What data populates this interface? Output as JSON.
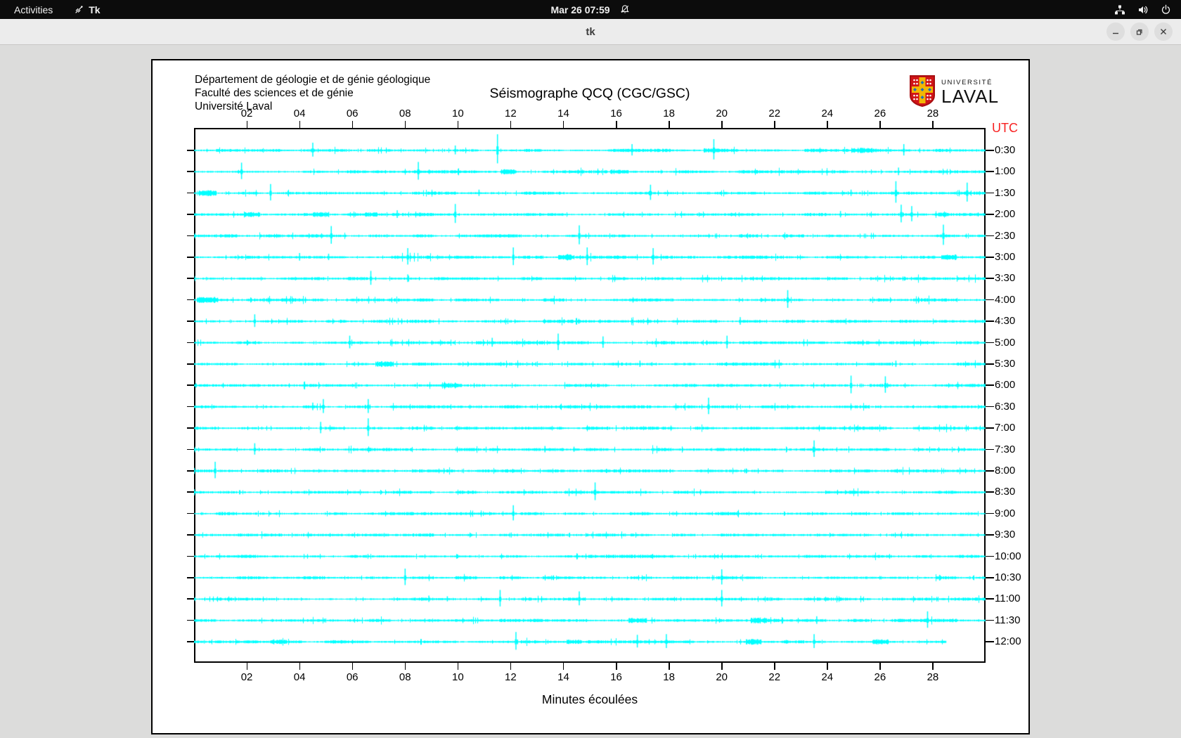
{
  "topbar": {
    "activities_label": "Activities",
    "app_menu_label": "Tk",
    "clock": "Mar 26 07:59"
  },
  "window": {
    "title": "tk"
  },
  "header": {
    "line1": "Département de géologie et de génie géologique",
    "line2": "Faculté des sciences et de génie",
    "line3": "Université Laval"
  },
  "logo": {
    "top": "UNIVERSITÉ",
    "bottom": "LAVAL"
  },
  "icons": {
    "topbar": [
      "tk-icon",
      "bell-muted-icon",
      "network-icon",
      "volume-icon",
      "power-icon"
    ],
    "window_controls": [
      "minimize-icon",
      "restore-icon",
      "close-icon"
    ]
  },
  "chart_data": {
    "type": "line",
    "subtype": "seismogram-helicorder",
    "title": "Séismographe QCQ (CGC/GSC)",
    "xlabel": "Minutes écoulées",
    "right_axis_label": "UTC",
    "right_axis_color": "#f82222",
    "trace_color": "#00ffff",
    "x_range_minutes": [
      0,
      30
    ],
    "x_ticks": [
      "02",
      "04",
      "06",
      "08",
      "10",
      "12",
      "14",
      "16",
      "18",
      "20",
      "22",
      "24",
      "26",
      "28"
    ],
    "grid": false,
    "rows": [
      {
        "label": "0:30",
        "end": 30,
        "spikes": [
          [
            4.5,
            11
          ],
          [
            9.9,
            7
          ],
          [
            11.5,
            23
          ],
          [
            16.6,
            9
          ],
          [
            19.7,
            16
          ],
          [
            26.9,
            9
          ]
        ],
        "patches": [
          [
            19.6,
            0.3,
            3
          ],
          [
            25.3,
            0.4,
            3.5
          ]
        ]
      },
      {
        "label": "1:00",
        "end": 30,
        "spikes": [
          [
            1.8,
            13
          ],
          [
            8.5,
            14
          ],
          [
            26.7,
            6
          ]
        ],
        "patches": [
          [
            11.9,
            0.3,
            3.5
          ],
          [
            16.1,
            0.35,
            3
          ]
        ]
      },
      {
        "label": "1:30",
        "end": 30,
        "spikes": [
          [
            2.9,
            13
          ],
          [
            10.8,
            5
          ],
          [
            17.3,
            12
          ],
          [
            24.9,
            5
          ],
          [
            26.6,
            17
          ],
          [
            29.3,
            15
          ]
        ],
        "patches": [
          [
            0.5,
            0.35,
            4
          ]
        ]
      },
      {
        "label": "2:00",
        "end": 30,
        "spikes": [
          [
            7.7,
            6
          ],
          [
            9.9,
            15
          ],
          [
            24.5,
            5
          ],
          [
            26.8,
            14
          ],
          [
            27.2,
            12
          ]
        ],
        "patches": [
          [
            2.2,
            0.3,
            3.5
          ],
          [
            4.8,
            0.3,
            3.5
          ],
          [
            6.7,
            0.25,
            3
          ],
          [
            28.4,
            0.2,
            3
          ]
        ]
      },
      {
        "label": "2:30",
        "end": 30,
        "spikes": [
          [
            5.2,
            14
          ],
          [
            14.6,
            15
          ],
          [
            28.4,
            16
          ]
        ],
        "patches": []
      },
      {
        "label": "3:00",
        "end": 30,
        "spikes": [
          [
            4.0,
            6
          ],
          [
            5.1,
            5
          ],
          [
            8.1,
            13
          ],
          [
            12.1,
            14
          ],
          [
            14.9,
            14
          ],
          [
            17.4,
            13
          ]
        ],
        "patches": [
          [
            14.1,
            0.3,
            4
          ],
          [
            28.6,
            0.3,
            4
          ]
        ]
      },
      {
        "label": "3:30",
        "end": 30,
        "spikes": [
          [
            6.7,
            11
          ],
          [
            8.1,
            6
          ]
        ],
        "patches": []
      },
      {
        "label": "4:00",
        "end": 30,
        "spikes": [
          [
            22.5,
            14
          ]
        ],
        "patches": [
          [
            0.5,
            0.4,
            4
          ]
        ]
      },
      {
        "label": "4:30",
        "end": 30,
        "spikes": [
          [
            2.3,
            10
          ],
          [
            20.7,
            6
          ]
        ],
        "patches": []
      },
      {
        "label": "5:00",
        "end": 30,
        "spikes": [
          [
            5.9,
            10
          ],
          [
            11.3,
            7
          ],
          [
            13.8,
            13
          ],
          [
            15.5,
            9
          ],
          [
            20.2,
            10
          ]
        ],
        "patches": []
      },
      {
        "label": "5:30",
        "end": 30,
        "spikes": [
          [
            16.9,
            5
          ],
          [
            26.6,
            5
          ]
        ],
        "patches": [
          [
            7.2,
            0.35,
            4
          ]
        ]
      },
      {
        "label": "6:00",
        "end": 30,
        "spikes": [
          [
            24.9,
            14
          ],
          [
            26.2,
            13
          ]
        ],
        "patches": [
          [
            9.8,
            0.3,
            3.5
          ]
        ]
      },
      {
        "label": "6:30",
        "end": 30,
        "spikes": [
          [
            4.5,
            6
          ],
          [
            4.9,
            11
          ],
          [
            6.6,
            11
          ],
          [
            19.5,
            13
          ]
        ],
        "patches": []
      },
      {
        "label": "7:00",
        "end": 30,
        "spikes": [
          [
            4.8,
            9
          ],
          [
            6.6,
            14
          ]
        ],
        "patches": []
      },
      {
        "label": "7:30",
        "end": 30,
        "spikes": [
          [
            2.3,
            9
          ],
          [
            13.3,
            5
          ],
          [
            14.4,
            4
          ],
          [
            23.5,
            13
          ]
        ],
        "patches": []
      },
      {
        "label": "8:00",
        "end": 30,
        "spikes": [
          [
            0.8,
            13
          ]
        ],
        "patches": []
      },
      {
        "label": "8:30",
        "end": 30,
        "spikes": [
          [
            15.2,
            14
          ]
        ],
        "patches": []
      },
      {
        "label": "9:00",
        "end": 30,
        "spikes": [
          [
            12.1,
            12
          ]
        ],
        "patches": []
      },
      {
        "label": "9:30",
        "end": 30,
        "spikes": [],
        "patches": []
      },
      {
        "label": "10:00",
        "end": 30,
        "spikes": [],
        "patches": []
      },
      {
        "label": "10:30",
        "end": 30,
        "spikes": [
          [
            8.0,
            13
          ],
          [
            20.0,
            12
          ]
        ],
        "patches": []
      },
      {
        "label": "11:00",
        "end": 30,
        "spikes": [
          [
            8.9,
            5
          ],
          [
            9.6,
            4
          ],
          [
            11.6,
            13
          ],
          [
            14.6,
            11
          ],
          [
            20.0,
            13
          ]
        ],
        "patches": []
      },
      {
        "label": "11:30",
        "end": 30,
        "spikes": [
          [
            23.6,
            6
          ],
          [
            27.8,
            13
          ]
        ],
        "patches": [
          [
            16.8,
            0.35,
            3.5
          ],
          [
            21.4,
            0.3,
            4
          ]
        ]
      },
      {
        "label": "12:00",
        "end": 28.5,
        "spikes": [
          [
            12.2,
            14
          ],
          [
            16.8,
            10
          ],
          [
            17.9,
            11
          ],
          [
            23.5,
            11
          ]
        ],
        "patches": [
          [
            3.2,
            0.3,
            3.5
          ],
          [
            14.4,
            0.3,
            3
          ],
          [
            21.2,
            0.3,
            4
          ],
          [
            26.0,
            0.3,
            3.5
          ]
        ]
      }
    ]
  }
}
